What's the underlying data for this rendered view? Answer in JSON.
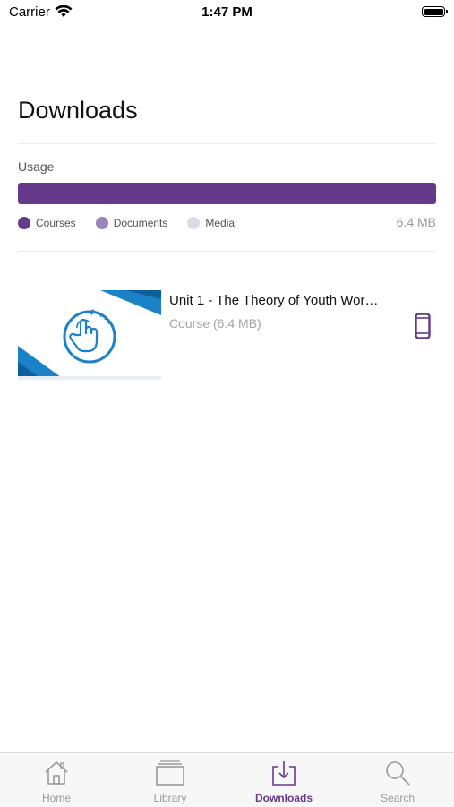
{
  "status_bar": {
    "carrier": "Carrier",
    "time": "1:47 PM"
  },
  "page": {
    "title": "Downloads"
  },
  "usage": {
    "label": "Usage",
    "total": "6.4 MB",
    "courses_fraction": 1.0,
    "legend": [
      {
        "label": "Courses",
        "color": "#663a8a"
      },
      {
        "label": "Documents",
        "color": "#9a85b7"
      },
      {
        "label": "Media",
        "color": "#dcdbe4"
      }
    ]
  },
  "downloads": [
    {
      "title": "Unit 1 - The Theory of Youth Wor…",
      "subtitle": "Course (6.4 MB)",
      "device_icon": "phone-icon"
    }
  ],
  "tabbar": {
    "tabs": [
      {
        "label": "Home",
        "icon": "home-icon",
        "active": false
      },
      {
        "label": "Library",
        "icon": "library-icon",
        "active": false
      },
      {
        "label": "Downloads",
        "icon": "download-icon",
        "active": true
      },
      {
        "label": "Search",
        "icon": "search-icon",
        "active": false
      }
    ]
  },
  "colors": {
    "accent": "#663a8a",
    "thumb_blue": "#1b82c8"
  }
}
